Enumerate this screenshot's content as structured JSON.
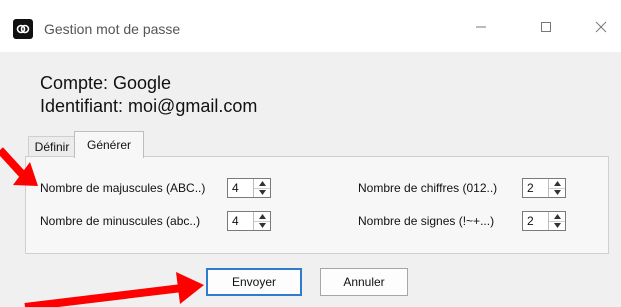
{
  "window": {
    "title": "Gestion mot de passe"
  },
  "account": {
    "line1": "Compte: Google",
    "line2": "Identifiant: moi@gmail.com"
  },
  "tabs": [
    {
      "label": "Définir"
    },
    {
      "label": "Générer"
    }
  ],
  "fields": {
    "majuscules": {
      "label": "Nombre de majuscules (ABC..)",
      "value": "4"
    },
    "minuscules": {
      "label": "Nombre de minuscules (abc..)",
      "value": "4"
    },
    "chiffres": {
      "label": "Nombre de chiffres (012..)",
      "value": "2"
    },
    "signes": {
      "label": "Nombre de signes (!~+...)",
      "value": "2"
    }
  },
  "buttons": {
    "send": "Envoyer",
    "cancel": "Annuler"
  },
  "colors": {
    "arrow": "#ff0000",
    "focus": "#2f7bd0"
  }
}
